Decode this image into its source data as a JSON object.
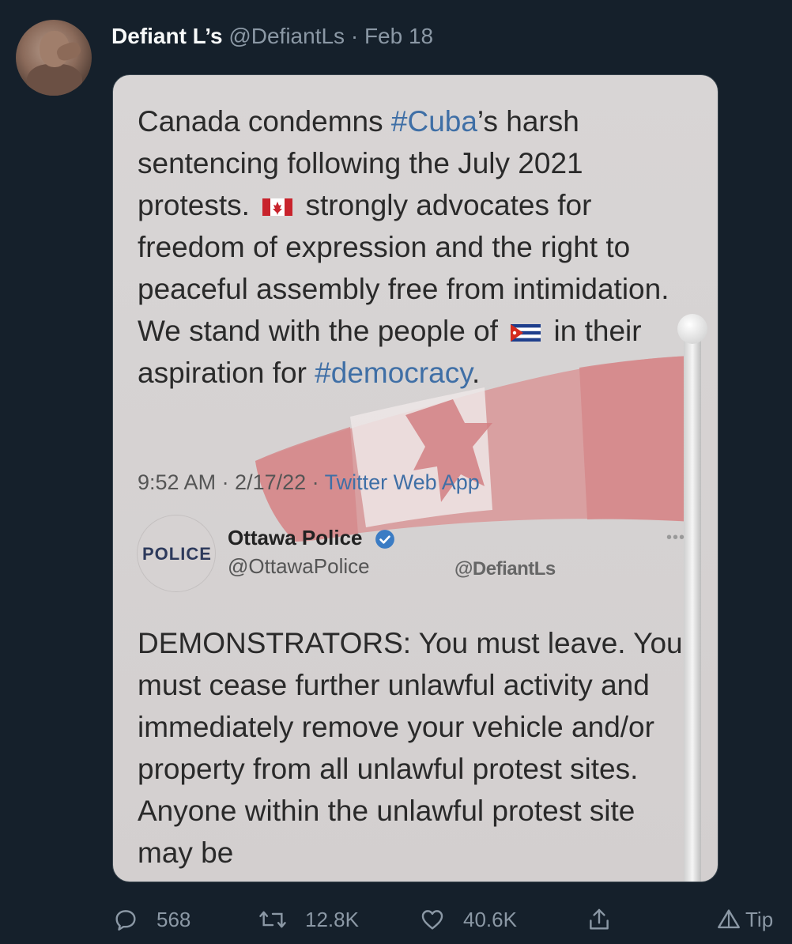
{
  "tweet": {
    "author_name": "Defiant L’s",
    "author_handle": "@DefiantLs",
    "separator": "·",
    "date": "Feb 18"
  },
  "screenshot": {
    "text_part1": "Canada condemns ",
    "hashtag_cuba": "#Cuba",
    "text_part2": "’s harsh sentencing following the July 2021 protests.",
    "text_part3": "strongly advocates for freedom of expression and the right to peaceful assembly free from intimidation. We stand with the people of",
    "text_part4": "in their aspiration for",
    "hashtag_democracy": "#democracy",
    "text_end": ".",
    "timestamp": "9:52 AM · 2/17/22 · ",
    "source": "Twitter Web App",
    "quoted_account_logo_text": "POLICE",
    "quoted_account_name": "Ottawa Police",
    "quoted_account_handle": "@OttawaPolice",
    "watermark": "@DefiantLs",
    "quoted_text": "DEMONSTRATORS: You must leave. You must cease further unlawful activity and immediately remove your vehicle and/or property from all unlawful protest sites. Anyone within the unlawful protest site may be",
    "more_icon": "more-dots-icon"
  },
  "actions": {
    "replies": "568",
    "retweets": "12.8K",
    "likes": "40.6K",
    "tip": "Tip"
  },
  "colors": {
    "background": "#15202b",
    "muted": "#8b98a5",
    "link": "#3f6fa6"
  }
}
